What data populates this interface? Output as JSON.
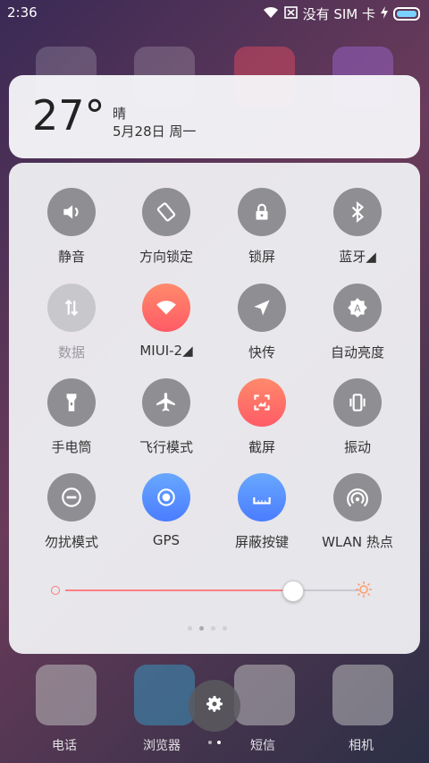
{
  "status": {
    "time": "2:36",
    "carrier": "没有 SIM 卡"
  },
  "weather": {
    "temperature": "27°",
    "condition": "晴",
    "date": "5月28日 周一"
  },
  "toggles": [
    {
      "label": "静音",
      "icon": "speaker-icon",
      "style": "gray"
    },
    {
      "label": "方向锁定",
      "icon": "rotation-lock-icon",
      "style": "gray"
    },
    {
      "label": "锁屏",
      "icon": "lock-icon",
      "style": "gray"
    },
    {
      "label": "蓝牙◢",
      "icon": "bluetooth-icon",
      "style": "gray"
    },
    {
      "label": "数据",
      "icon": "data-arrows-icon",
      "style": "lightgray"
    },
    {
      "label": "MIUI-2◢",
      "icon": "wifi-icon",
      "style": "orange"
    },
    {
      "label": "快传",
      "icon": "send-icon",
      "style": "gray"
    },
    {
      "label": "自动亮度",
      "icon": "auto-brightness-icon",
      "style": "gray"
    },
    {
      "label": "手电筒",
      "icon": "flashlight-icon",
      "style": "gray"
    },
    {
      "label": "飞行模式",
      "icon": "airplane-icon",
      "style": "gray"
    },
    {
      "label": "截屏",
      "icon": "screenshot-icon",
      "style": "orange"
    },
    {
      "label": "振动",
      "icon": "vibrate-icon",
      "style": "gray"
    },
    {
      "label": "勿扰模式",
      "icon": "do-not-disturb-icon",
      "style": "gray"
    },
    {
      "label": "GPS",
      "icon": "gps-icon",
      "style": "blue"
    },
    {
      "label": "屏蔽按键",
      "icon": "block-keys-icon",
      "style": "blue"
    },
    {
      "label": "WLAN 热点",
      "icon": "hotspot-icon",
      "style": "gray"
    }
  ],
  "brightness": {
    "level": 0.77
  },
  "dock": [
    {
      "label": "电话"
    },
    {
      "label": "浏览器"
    },
    {
      "label": "短信"
    },
    {
      "label": "相机"
    }
  ],
  "colors": {
    "accent": "#ff7f86",
    "toggle_gray": "#8e8e93",
    "toggle_blue": "#5b8dff"
  }
}
